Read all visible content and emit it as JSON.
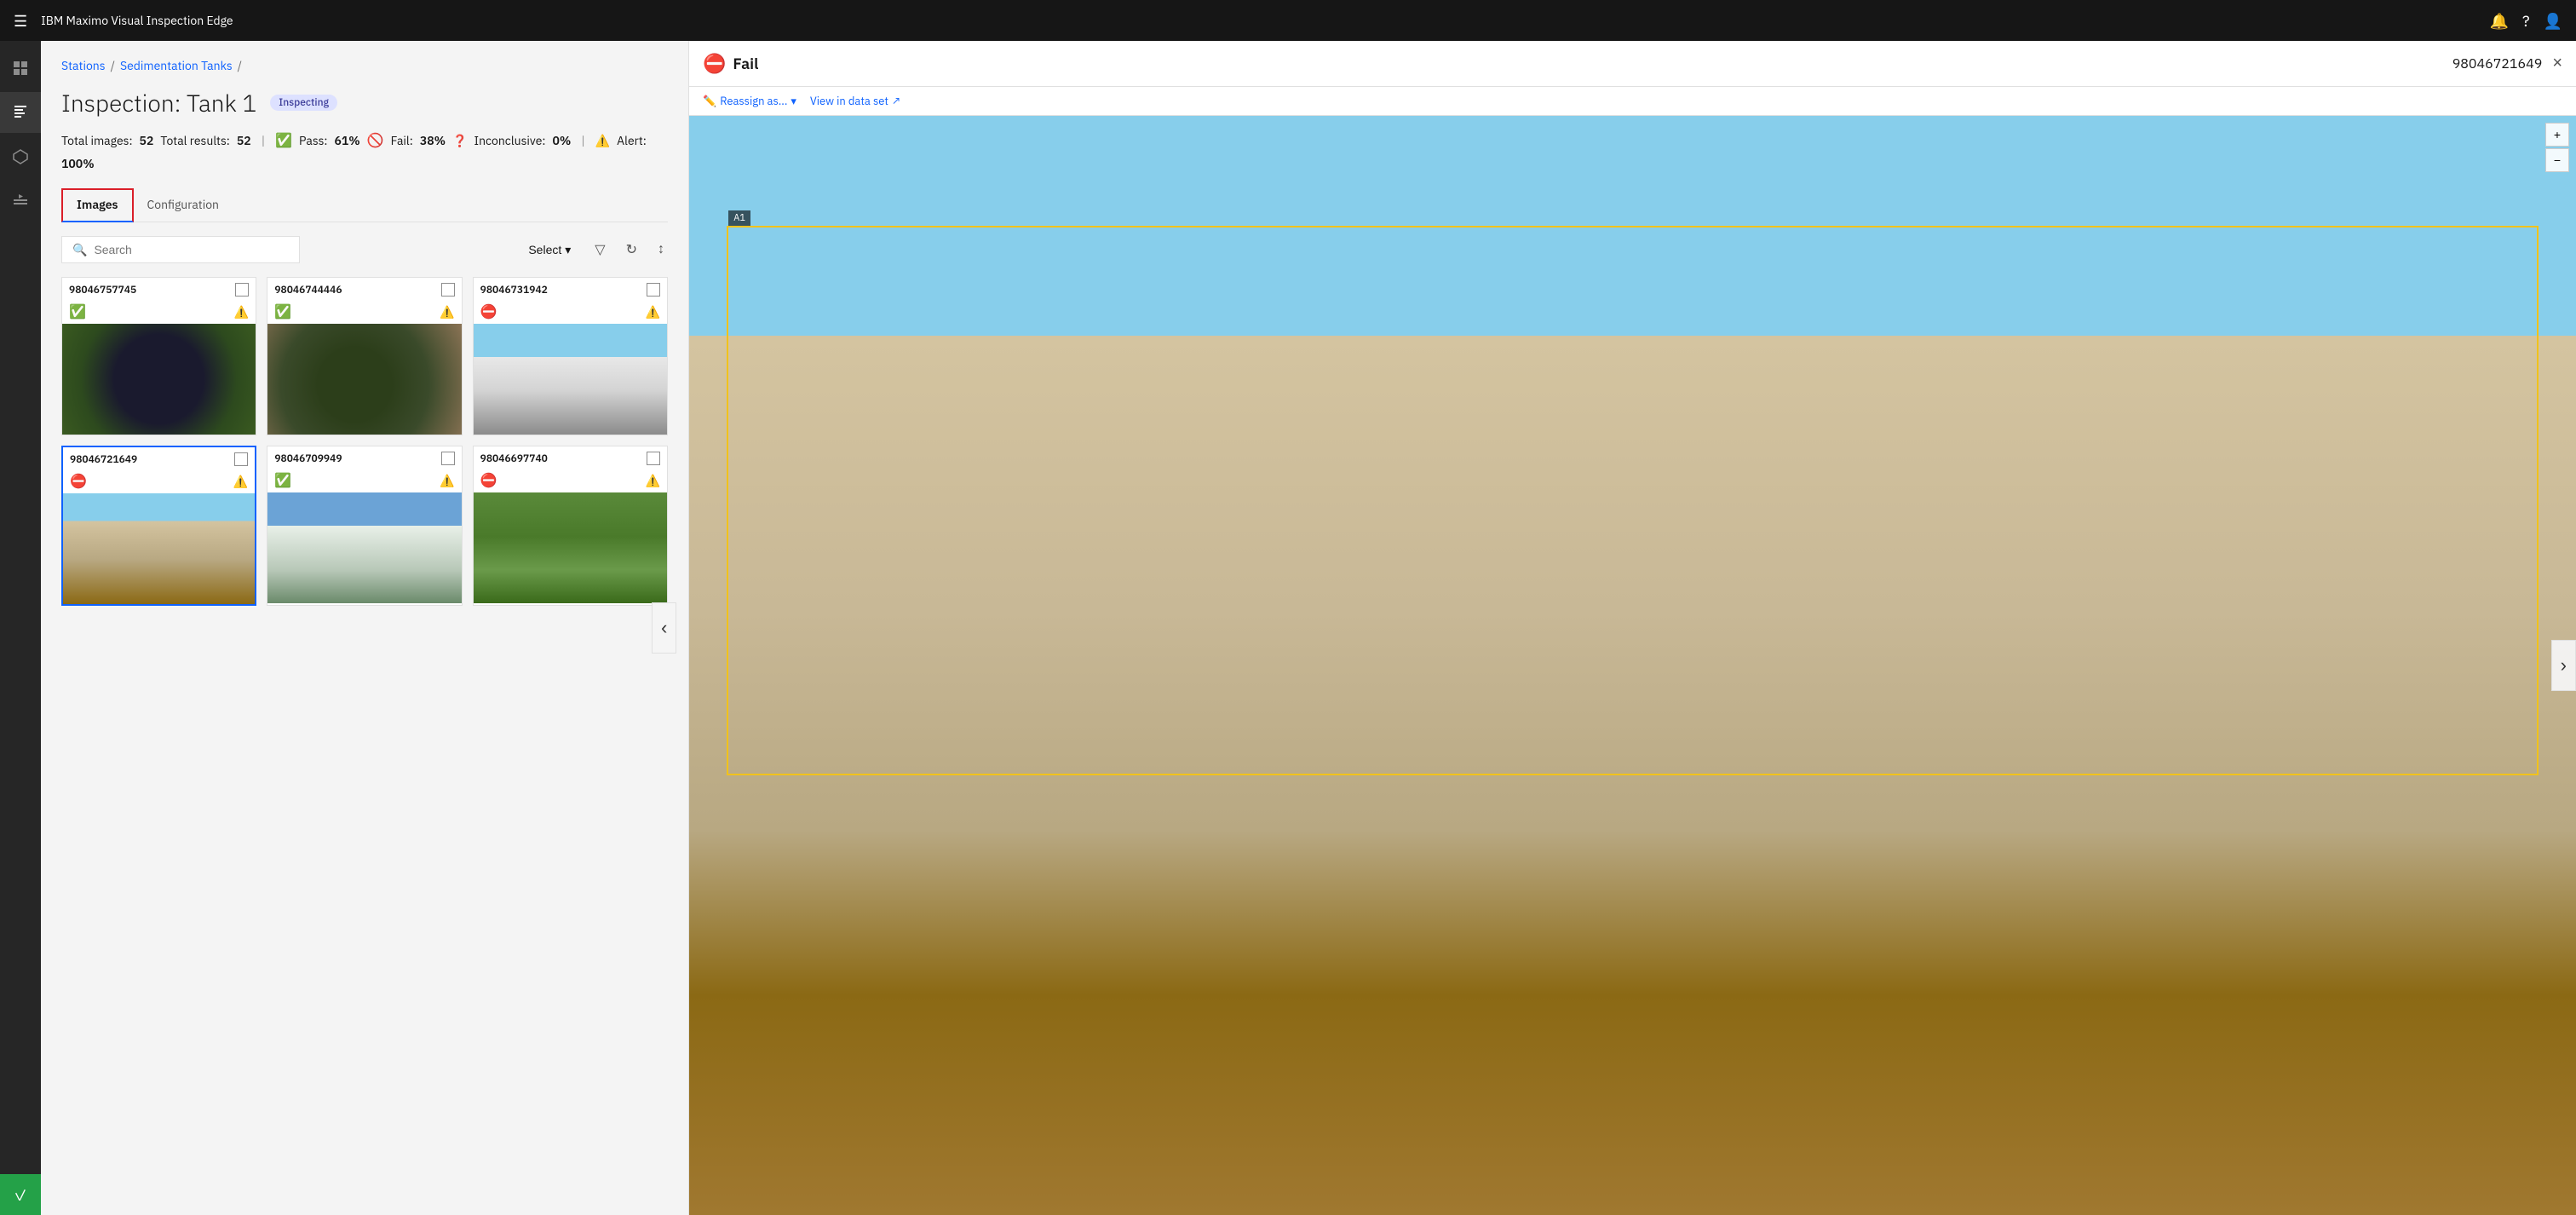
{
  "topnav": {
    "title": "IBM Maximo Visual Inspection Edge",
    "hamburger": "☰",
    "icons": [
      "🔔",
      "?",
      "👤"
    ]
  },
  "breadcrumb": {
    "items": [
      "Stations",
      "Sedimentation Tanks"
    ],
    "separator": "/"
  },
  "page": {
    "title": "Inspection: Tank 1",
    "status_badge": "Inspecting"
  },
  "stats": {
    "total_images_label": "Total images:",
    "total_images_value": "52",
    "total_results_label": "Total results:",
    "total_results_value": "52",
    "pass_label": "Pass:",
    "pass_value": "61%",
    "fail_label": "Fail:",
    "fail_value": "38%",
    "inconclusive_label": "Inconclusive:",
    "inconclusive_value": "0%",
    "alert_label": "Alert:",
    "alert_value": "100%"
  },
  "tabs": {
    "images_label": "Images",
    "configuration_label": "Configuration"
  },
  "toolbar": {
    "search_placeholder": "Search",
    "select_label": "Select",
    "filter_icon": "▽",
    "refresh_icon": "↻",
    "sort_icon": "↕"
  },
  "images": [
    {
      "id": "98046757745",
      "pass": true,
      "alert": true,
      "img_class": "img-tank1",
      "selected": false
    },
    {
      "id": "98046744446",
      "pass": true,
      "alert": true,
      "img_class": "img-tank2",
      "selected": false
    },
    {
      "id": "98046731942",
      "pass": false,
      "fail": true,
      "alert": true,
      "img_class": "img-tank3",
      "selected": false
    },
    {
      "id": "98046721649",
      "pass": false,
      "fail": true,
      "alert": true,
      "img_class": "img-tank4",
      "selected": true
    },
    {
      "id": "98046709949",
      "pass": true,
      "alert": true,
      "img_class": "img-tank5",
      "selected": false
    },
    {
      "id": "98046697740",
      "pass": false,
      "fail": true,
      "alert": true,
      "img_class": "img-tank6",
      "selected": false
    }
  ],
  "detail": {
    "status": "Fail",
    "id": "98046721649",
    "reassign_label": "Reassign as...",
    "view_label": "View in data set",
    "annotation_label": "A1",
    "zoom_in": "+",
    "zoom_out": "−",
    "nav_prev": "‹",
    "nav_next": "›",
    "close": "×"
  },
  "sidebar": {
    "items": [
      {
        "icon": "☰",
        "name": "menu"
      },
      {
        "icon": "⊞",
        "name": "dashboard"
      },
      {
        "icon": "📋",
        "name": "inspections"
      },
      {
        "icon": "◈",
        "name": "models"
      },
      {
        "icon": "▶",
        "name": "deploy"
      }
    ],
    "active_icon": "✓"
  }
}
